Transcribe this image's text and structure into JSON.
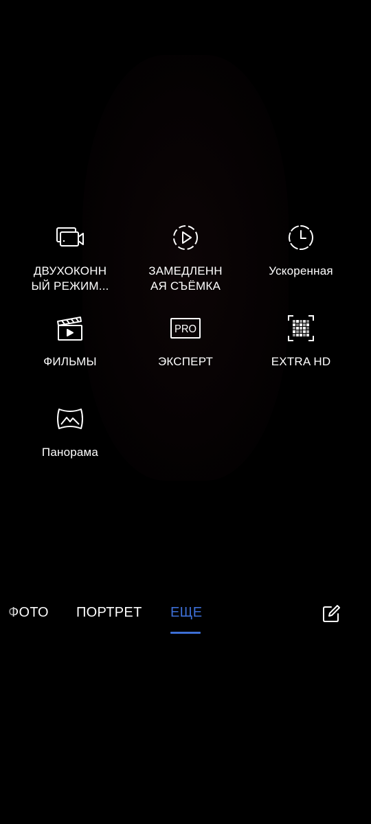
{
  "modes": [
    {
      "label": "ДВУХОКОНН\nЫЙ РЕЖИМ...",
      "icon": "dual-view-camera-icon"
    },
    {
      "label": "ЗАМЕДЛЕНН\nАЯ СЪЁМКА",
      "icon": "slow-motion-icon"
    },
    {
      "label": "Ускоренная",
      "icon": "time-lapse-icon"
    },
    {
      "label": "ФИЛЬМЫ",
      "icon": "clapperboard-icon"
    },
    {
      "label": "ЭКСПЕРТ",
      "icon": "pro-mode-icon"
    },
    {
      "label": "EXTRA HD",
      "icon": "extra-hd-icon"
    },
    {
      "label": "Панорама",
      "icon": "panorama-icon"
    }
  ],
  "pro_badge": "PRO",
  "mode_bar": {
    "tabs": [
      {
        "label": "ФОТО"
      },
      {
        "label": "ПОРТРЕТ"
      },
      {
        "label": "ЕЩЕ",
        "selected": true
      }
    ],
    "edit_icon": "edit-icon"
  },
  "colors": {
    "background": "#000000",
    "text": "#ffffff",
    "accent": "#3d6fd6"
  }
}
